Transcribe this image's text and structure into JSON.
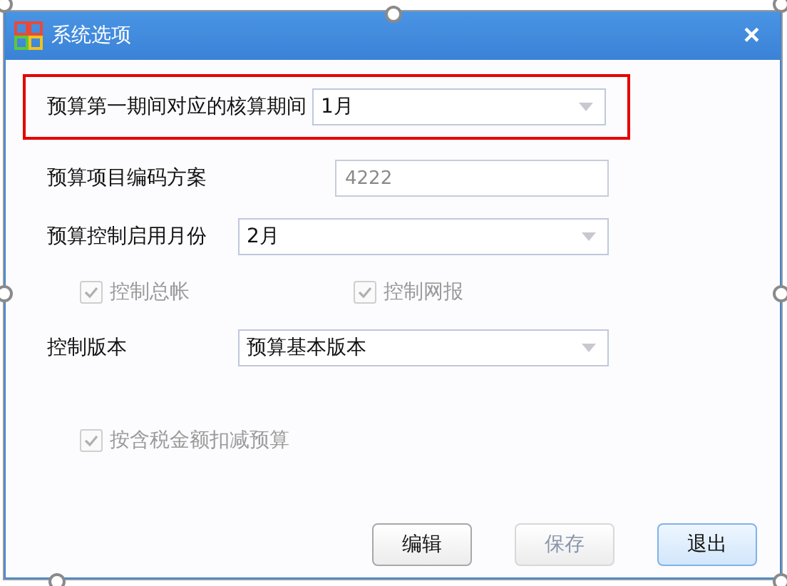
{
  "window": {
    "title": "系统选项",
    "close": "×"
  },
  "rows": [
    {
      "kind": "select",
      "label": "预算第一期间对应的核算期间",
      "value": "1月",
      "highlighted": true
    },
    {
      "kind": "input",
      "label": "预算项目编码方案",
      "value": "4222",
      "disabled": true
    },
    {
      "kind": "select",
      "label": "预算控制启用月份",
      "value": "2月",
      "highlighted": false
    },
    {
      "kind": "checks",
      "items": [
        {
          "label": "控制总帐",
          "checked": true,
          "disabled": true
        },
        {
          "label": "控制网报",
          "checked": true,
          "disabled": true
        }
      ]
    },
    {
      "kind": "select",
      "label": "控制版本",
      "value": "预算基本版本",
      "highlighted": false
    },
    {
      "kind": "checks",
      "items": [
        {
          "label": "按含税金额扣减预算",
          "checked": true,
          "disabled": true
        }
      ]
    }
  ],
  "buttons": [
    {
      "label": "编辑",
      "disabled": false,
      "focused": false
    },
    {
      "label": "保存",
      "disabled": true,
      "focused": false
    },
    {
      "label": "退出",
      "disabled": false,
      "focused": true
    }
  ]
}
